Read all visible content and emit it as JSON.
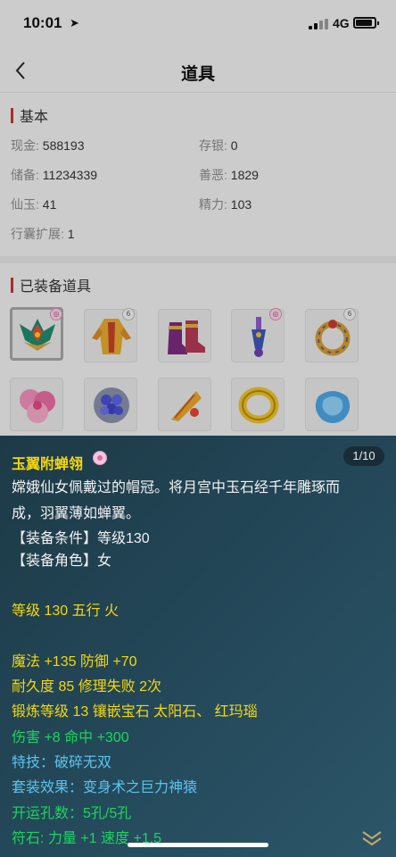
{
  "status_bar": {
    "time": "10:01",
    "network": "4G"
  },
  "nav": {
    "title": "道具"
  },
  "basic": {
    "title": "基本",
    "fields": [
      {
        "label": "现金:",
        "value": "588193"
      },
      {
        "label": "存银:",
        "value": "0"
      },
      {
        "label": "储备:",
        "value": "11234339"
      },
      {
        "label": "善恶:",
        "value": "1829"
      },
      {
        "label": "仙玉:",
        "value": "41"
      },
      {
        "label": "精力:",
        "value": "103"
      },
      {
        "label": "行囊扩展:",
        "value": "1"
      }
    ]
  },
  "equipped": {
    "title": "已装备道具",
    "badge_text": "6",
    "items": [
      {
        "icon": "jade-wing-crown-icon",
        "selected": true
      },
      {
        "icon": "golden-robe-icon"
      },
      {
        "icon": "purple-boots-icon"
      },
      {
        "icon": "blue-pendant-icon"
      },
      {
        "icon": "golden-ring-icon"
      },
      {
        "icon": "pink-flower-icon"
      },
      {
        "icon": "blue-grape-orb-icon"
      },
      {
        "icon": "golden-feather-icon"
      },
      {
        "icon": "gold-bracelet-icon"
      },
      {
        "icon": "blue-jade-icon"
      }
    ]
  },
  "detail": {
    "name": "玉翼附蝉翎",
    "page": "1/10",
    "description": "嫦娥仙女佩戴过的帽冠。将月宫中玉石经千年雕琢而成，羽翼薄如蝉翼。",
    "requirement": "【装备条件】等级130",
    "role": "【装备角色】女",
    "level_line": "等级 130 五行 火",
    "stats_line": "魔法 +135 防御 +70",
    "durability_line": "耐久度 85 修理失败 2次",
    "forge_line": "锻炼等级 13 镶嵌宝石 太阳石、 红玛瑙",
    "damage_line": "伤害 +8 命中 +300",
    "skill_line": "特技：破碎无双",
    "set_line": "套装效果：变身术之巨力神猿",
    "holes_line": "开运孔数：5孔/5孔",
    "rune_line": "符石: 力量 +1 速度 +1.5"
  }
}
